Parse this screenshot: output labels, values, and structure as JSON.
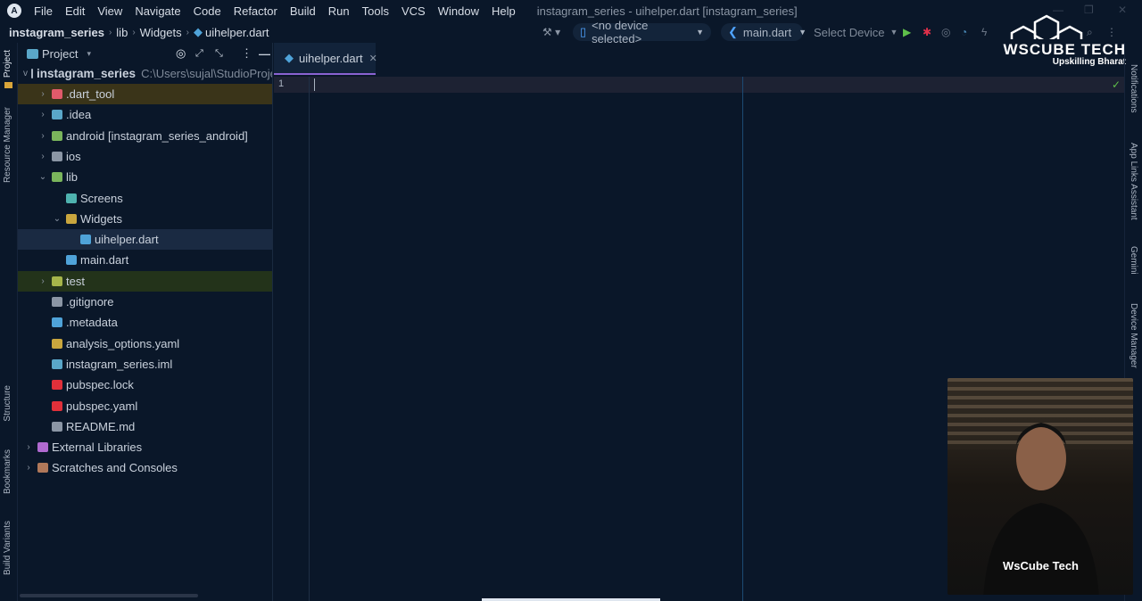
{
  "menubar": {
    "items": [
      "File",
      "Edit",
      "View",
      "Navigate",
      "Code",
      "Refactor",
      "Build",
      "Run",
      "Tools",
      "VCS",
      "Window",
      "Help"
    ],
    "title": "instagram_series - uihelper.dart [instagram_series]"
  },
  "breadcrumb": [
    "instagram_series",
    "lib",
    "Widgets",
    "uihelper.dart"
  ],
  "toolbar": {
    "device": "<no device selected>",
    "run_config": "main.dart",
    "select_device": "Select Device"
  },
  "left_strip": [
    "Project",
    "Resource Manager",
    "Structure",
    "Bookmarks",
    "Build Variants"
  ],
  "right_strip": [
    "Notifications",
    "App Links Assistant",
    "Gemini",
    "Device Manager"
  ],
  "project": {
    "title": "Project",
    "root": "instagram_series",
    "root_path": "C:\\Users\\sujal\\StudioProje",
    "items": [
      {
        "label": ".dart_tool",
        "depth": 1,
        "chev": ">",
        "color": "#e05a6a",
        "bg": "#3a3419"
      },
      {
        "label": ".idea",
        "depth": 1,
        "chev": ">",
        "color": "#5aa7c9"
      },
      {
        "label": "android [instagram_series_android]",
        "depth": 1,
        "chev": ">",
        "color": "#7ab55c"
      },
      {
        "label": "ios",
        "depth": 1,
        "chev": ">",
        "color": "#8b96a5"
      },
      {
        "label": "lib",
        "depth": 1,
        "chev": "v",
        "color": "#7ab55c"
      },
      {
        "label": "Screens",
        "depth": 2,
        "chev": "",
        "color": "#4fb3b0"
      },
      {
        "label": "Widgets",
        "depth": 2,
        "chev": "v",
        "color": "#c9a63e"
      },
      {
        "label": "uihelper.dart",
        "depth": 3,
        "chev": "",
        "color": "#4fa3d9",
        "bg": "#1a2a42"
      },
      {
        "label": "main.dart",
        "depth": 2,
        "chev": "",
        "color": "#4fa3d9"
      },
      {
        "label": "test",
        "depth": 1,
        "chev": ">",
        "color": "#a6b54a",
        "bg": "#23331a"
      },
      {
        "label": ".gitignore",
        "depth": 1,
        "chev": "",
        "color": "#8b96a5"
      },
      {
        "label": ".metadata",
        "depth": 1,
        "chev": "",
        "color": "#4fa3d9"
      },
      {
        "label": "analysis_options.yaml",
        "depth": 1,
        "chev": "",
        "color": "#c9a63e"
      },
      {
        "label": "instagram_series.iml",
        "depth": 1,
        "chev": "",
        "color": "#5aa7c9"
      },
      {
        "label": "pubspec.lock",
        "depth": 1,
        "chev": "",
        "color": "#e0303a"
      },
      {
        "label": "pubspec.yaml",
        "depth": 1,
        "chev": "",
        "color": "#e0303a"
      },
      {
        "label": "README.md",
        "depth": 1,
        "chev": "",
        "color": "#8b96a5"
      },
      {
        "label": "External Libraries",
        "depth": 0,
        "chev": ">",
        "color": "#b06ad0"
      },
      {
        "label": "Scratches and Consoles",
        "depth": 0,
        "chev": ">",
        "color": "#b0785a"
      }
    ]
  },
  "editor": {
    "tab": "uihelper.dart",
    "line_number": "1"
  },
  "watermark": {
    "brand": "WsCube Tech",
    "tagline": "Upskilling Bharat"
  }
}
